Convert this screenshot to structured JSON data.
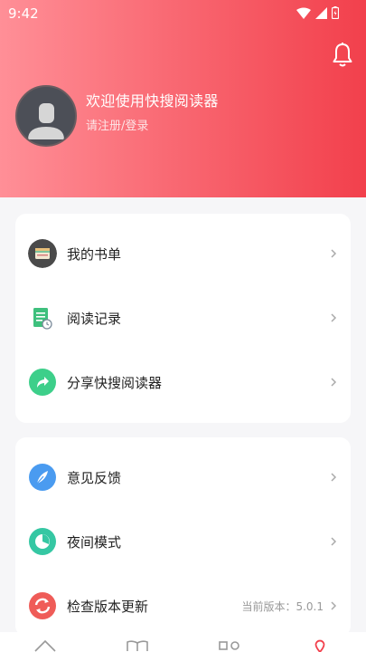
{
  "status_bar": {
    "time": "9:42"
  },
  "profile": {
    "welcome": "欢迎使用快搜阅读器",
    "register": "请注册/登录"
  },
  "menu_group_1": [
    {
      "label": "我的书单"
    },
    {
      "label": "阅读记录"
    },
    {
      "label": "分享快搜阅读器"
    }
  ],
  "menu_group_2": [
    {
      "label": "意见反馈"
    },
    {
      "label": "夜间模式"
    },
    {
      "label": "检查版本更新",
      "extra": "当前版本：5.0.1"
    }
  ],
  "icons": {
    "bell": "bell-icon",
    "booklist": "booklist-icon",
    "reading_record": "reading-record-icon",
    "share": "share-icon",
    "feedback": "feedback-icon",
    "night_mode": "night-mode-icon",
    "update": "update-icon"
  },
  "colors": {
    "header_start": "#ff8f97",
    "header_end": "#f2404c",
    "share_green": "#3dcf8a",
    "feedback_blue": "#4a9bf0",
    "night_teal": "#35c7a3",
    "update_red": "#ef5c58"
  }
}
